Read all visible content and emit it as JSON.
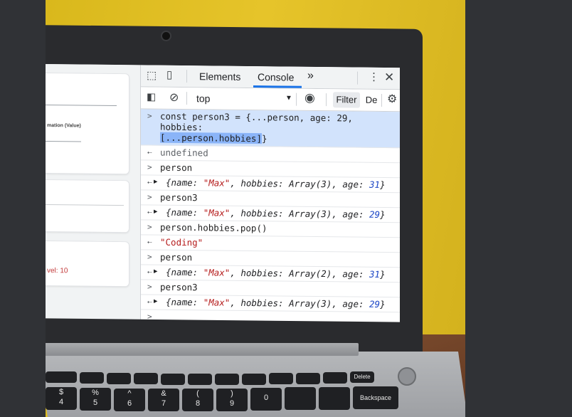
{
  "web_page": {
    "field_label": "mation (Value)",
    "status_text": "vel: 10"
  },
  "devtools": {
    "tabs": [
      "Elements",
      "Console"
    ],
    "more_tabs_glyph": "»",
    "context_select": "top",
    "filter_label": "Filter",
    "levels_label": "De"
  },
  "console": {
    "line1_prefix": "const person3 = {...person, age: 29, hobbies:",
    "line1_selected": "[...person.hobbies]",
    "line1_suffix": "}",
    "out1": "undefined",
    "in2": "person",
    "out2": {
      "name": "\"Max\"",
      "hobbies": "Array(3)",
      "age": "31"
    },
    "in3": "person3",
    "out3": {
      "name": "\"Max\"",
      "hobbies": "Array(3)",
      "age": "29"
    },
    "in4": "person.hobbies.pop()",
    "out4": "\"Coding\"",
    "in5": "person",
    "out5": {
      "name": "\"Max\"",
      "hobbies": "Array(2)",
      "age": "31"
    },
    "in6": "person3",
    "out6": {
      "name": "\"Max\"",
      "hobbies": "Array(3)",
      "age": "29"
    }
  },
  "keyboard": {
    "backspace": "Backspace",
    "delete": "Delete",
    "digits": [
      "4",
      "5",
      "6",
      "7",
      "8",
      "9",
      "0"
    ],
    "shift_symbols": [
      "$",
      "%",
      "^",
      "&",
      "(",
      ")"
    ]
  },
  "colors": {
    "wall": "#e6c42a",
    "selection": "#d2e3fc",
    "string": "#b51c1c",
    "number": "#1c46c6"
  }
}
